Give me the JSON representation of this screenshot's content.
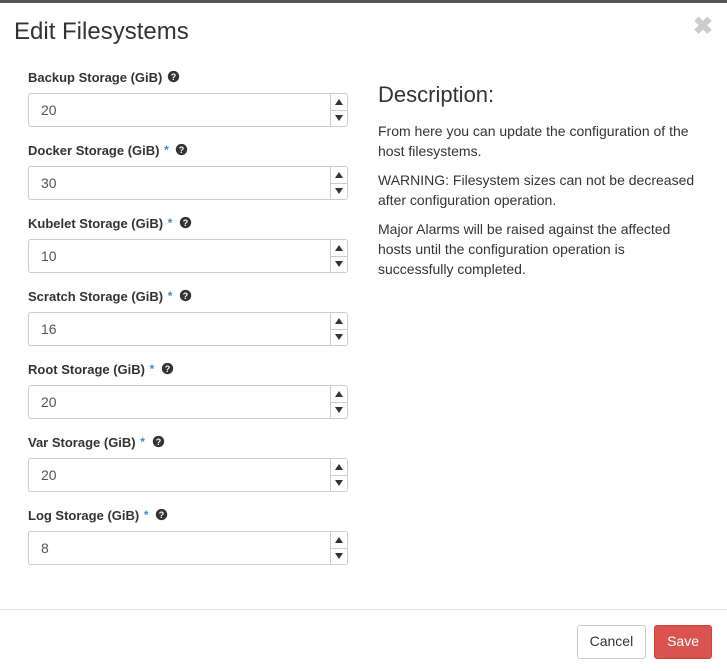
{
  "modal": {
    "title": "Edit Filesystems"
  },
  "description": {
    "heading": "Description:",
    "text1": "From here you can update the configuration of the host filesystems.",
    "text2": "WARNING: Filesystem sizes can not be decreased after configuration operation.",
    "text3": "Major Alarms will be raised against the affected hosts until the configuration operation is successfully completed."
  },
  "fields": {
    "backup": {
      "label": "Backup Storage (GiB)",
      "value": "20",
      "required": false
    },
    "docker": {
      "label": "Docker Storage (GiB)",
      "value": "30",
      "required": true
    },
    "kubelet": {
      "label": "Kubelet Storage (GiB)",
      "value": "10",
      "required": true
    },
    "scratch": {
      "label": "Scratch Storage (GiB)",
      "value": "16",
      "required": true
    },
    "root": {
      "label": "Root Storage (GiB)",
      "value": "20",
      "required": true
    },
    "var": {
      "label": "Var Storage (GiB)",
      "value": "20",
      "required": true
    },
    "log": {
      "label": "Log Storage (GiB)",
      "value": "8",
      "required": true
    }
  },
  "footer": {
    "cancel": "Cancel",
    "save": "Save"
  }
}
